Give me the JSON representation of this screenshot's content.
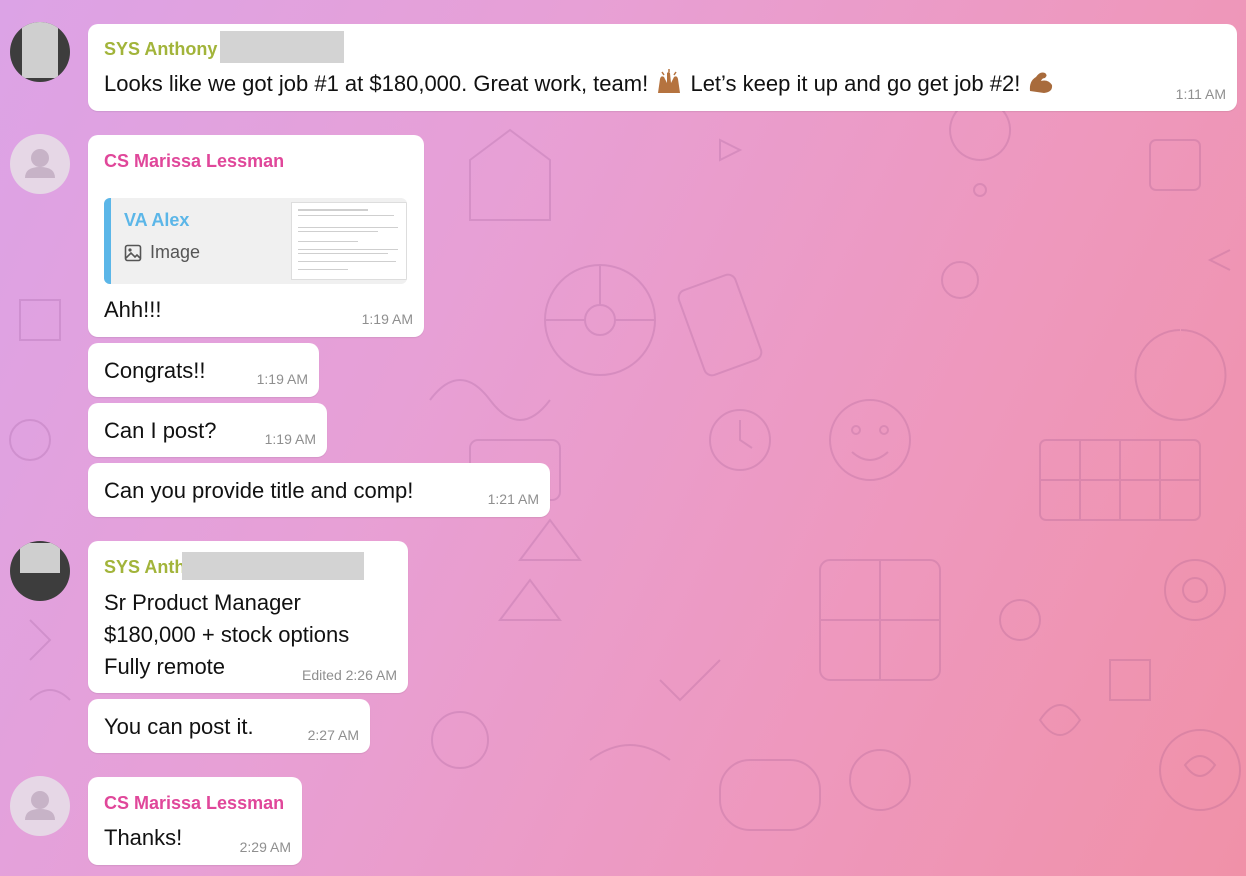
{
  "messages": [
    {
      "sender": "SYS Anthony",
      "text_before": "Looks like we got job #1 at $180,000. Great work, team!",
      "text_middle": "Let’s keep it up and go get job #2!",
      "time": "1:11 AM",
      "emoji_1": "raising-hands-emoji",
      "emoji_2": "flexed-biceps-emoji"
    },
    {
      "sender": "CS Marissa Lessman",
      "reply_name": "VA Alex",
      "reply_type": "Image",
      "text": "Ahh!!!",
      "time": "1:19 AM"
    },
    {
      "text": "Congrats!!",
      "time": "1:19 AM"
    },
    {
      "text": "Can I post?",
      "time": "1:19 AM"
    },
    {
      "text": "Can you provide title and comp!",
      "time": "1:21 AM"
    },
    {
      "sender": "SYS Anth",
      "lines": [
        "Sr Product Manager",
        "$180,000 + stock options",
        "Fully remote"
      ],
      "time": "Edited 2:26 AM"
    },
    {
      "text": "You can post it.",
      "time": "2:27 AM"
    },
    {
      "sender": "CS Marissa Lessman",
      "text": "Thanks!",
      "time": "2:29 AM"
    }
  ],
  "colors": {
    "green_sender": "#a2b43a",
    "pink_sender": "#e0479a",
    "reply_accent": "#5bb6e8"
  }
}
